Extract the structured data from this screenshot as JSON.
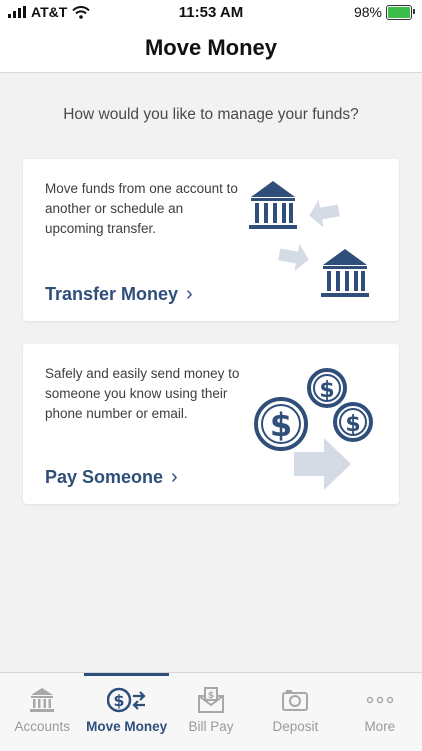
{
  "status_bar": {
    "carrier": "AT&T",
    "time": "11:53 AM",
    "battery": "98%"
  },
  "header": {
    "title": "Move Money"
  },
  "prompt": "How would you like to manage your funds?",
  "cards": [
    {
      "description": "Move funds from one account to another or schedule an upcoming transfer.",
      "action_label": "Transfer Money",
      "icon": "bank-transfer-illustration"
    },
    {
      "description": "Safely and easily send money to someone you know using their phone number or email.",
      "action_label": "Pay Someone",
      "icon": "send-money-illustration"
    }
  ],
  "tabs": [
    {
      "label": "Accounts",
      "icon": "bank-icon",
      "active": false
    },
    {
      "label": "Move Money",
      "icon": "move-money-icon",
      "active": true
    },
    {
      "label": "Bill Pay",
      "icon": "bill-envelope-icon",
      "active": false
    },
    {
      "label": "Deposit",
      "icon": "camera-icon",
      "active": false
    },
    {
      "label": "More",
      "icon": "more-dots-icon",
      "active": false
    }
  ],
  "colors": {
    "accent": "#2f4f7a",
    "illustration_light": "#d4dbe4",
    "background": "#f2f2f2"
  }
}
